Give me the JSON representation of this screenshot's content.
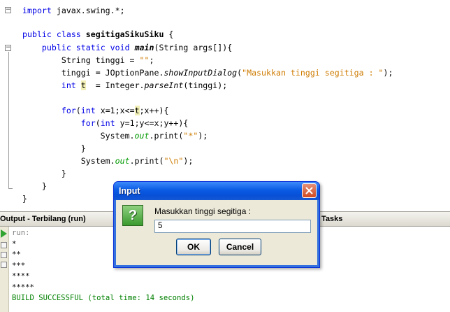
{
  "editor": {
    "lines": [
      {
        "id": "l1",
        "parts": [
          {
            "t": "import",
            "c": "kw"
          },
          {
            "t": " javax.swing.*;",
            "c": ""
          }
        ]
      },
      {
        "id": "l2",
        "parts": []
      },
      {
        "id": "l3",
        "parts": [
          {
            "t": "public",
            "c": "kw"
          },
          {
            "t": " ",
            "c": ""
          },
          {
            "t": "class",
            "c": "kw"
          },
          {
            "t": " ",
            "c": ""
          },
          {
            "t": "segitigaSikuSiku",
            "c": "bold"
          },
          {
            "t": " {",
            "c": ""
          }
        ]
      },
      {
        "id": "l4",
        "parts": [
          {
            "t": "    ",
            "c": ""
          },
          {
            "t": "public",
            "c": "kw"
          },
          {
            "t": " ",
            "c": ""
          },
          {
            "t": "static",
            "c": "kw"
          },
          {
            "t": " ",
            "c": ""
          },
          {
            "t": "void",
            "c": "kw"
          },
          {
            "t": " ",
            "c": ""
          },
          {
            "t": "main",
            "c": "bold it"
          },
          {
            "t": "(String args[]){",
            "c": ""
          }
        ]
      },
      {
        "id": "l5",
        "parts": [
          {
            "t": "        String tinggi = ",
            "c": ""
          },
          {
            "t": "\"\"",
            "c": "str"
          },
          {
            "t": ";",
            "c": ""
          }
        ]
      },
      {
        "id": "l6",
        "parts": [
          {
            "t": "        tinggi = JOptionPane.",
            "c": ""
          },
          {
            "t": "showInputDialog",
            "c": "it"
          },
          {
            "t": "(",
            "c": ""
          },
          {
            "t": "\"Masukkan tinggi segitiga : \"",
            "c": "str"
          },
          {
            "t": ");",
            "c": ""
          }
        ]
      },
      {
        "id": "l7",
        "parts": [
          {
            "t": "        ",
            "c": ""
          },
          {
            "t": "int",
            "c": "kw"
          },
          {
            "t": " ",
            "c": ""
          },
          {
            "t": "t",
            "c": "hl"
          },
          {
            "t": "  = Integer.",
            "c": ""
          },
          {
            "t": "parseInt",
            "c": "it"
          },
          {
            "t": "(tinggi);",
            "c": ""
          }
        ]
      },
      {
        "id": "l8",
        "parts": []
      },
      {
        "id": "l9",
        "parts": [
          {
            "t": "        ",
            "c": ""
          },
          {
            "t": "for",
            "c": "kw"
          },
          {
            "t": "(",
            "c": ""
          },
          {
            "t": "int",
            "c": "kw"
          },
          {
            "t": " x=1;x<=",
            "c": ""
          },
          {
            "t": "t",
            "c": "hl"
          },
          {
            "t": ";x++){",
            "c": ""
          }
        ]
      },
      {
        "id": "l10",
        "parts": [
          {
            "t": "            ",
            "c": ""
          },
          {
            "t": "for",
            "c": "kw"
          },
          {
            "t": "(",
            "c": ""
          },
          {
            "t": "int",
            "c": "kw"
          },
          {
            "t": " y=1;y<=x;y++){",
            "c": ""
          }
        ]
      },
      {
        "id": "l11",
        "parts": [
          {
            "t": "                System.",
            "c": ""
          },
          {
            "t": "out",
            "c": "fld"
          },
          {
            "t": ".print(",
            "c": ""
          },
          {
            "t": "\"*\"",
            "c": "str"
          },
          {
            "t": ");",
            "c": ""
          }
        ]
      },
      {
        "id": "l12",
        "parts": [
          {
            "t": "            }",
            "c": ""
          }
        ]
      },
      {
        "id": "l13",
        "parts": [
          {
            "t": "            System.",
            "c": ""
          },
          {
            "t": "out",
            "c": "fld"
          },
          {
            "t": ".print(",
            "c": ""
          },
          {
            "t": "\"\\n\"",
            "c": "str"
          },
          {
            "t": ");",
            "c": ""
          }
        ]
      },
      {
        "id": "l14",
        "parts": [
          {
            "t": "        }",
            "c": ""
          }
        ]
      },
      {
        "id": "l15",
        "parts": [
          {
            "t": "    }",
            "c": ""
          }
        ]
      },
      {
        "id": "l16",
        "parts": [
          {
            "t": "}",
            "c": ""
          }
        ]
      }
    ]
  },
  "output_panel": {
    "tab_label": "Output - Terbilang (run)",
    "tasks_tab_label": "Tasks",
    "lines": [
      {
        "text": "run:",
        "style": "out-gray"
      },
      {
        "text": "*",
        "style": "out-black"
      },
      {
        "text": "**",
        "style": "out-black"
      },
      {
        "text": "***",
        "style": "out-black"
      },
      {
        "text": "****",
        "style": "out-black"
      },
      {
        "text": "*****",
        "style": "out-black"
      },
      {
        "text": "BUILD SUCCESSFUL (total time: 14 seconds)",
        "style": "out-green"
      }
    ]
  },
  "dialog": {
    "title": "Input",
    "icon": "question-icon",
    "icon_glyph": "?",
    "prompt": "Masukkan tinggi segitiga :",
    "input_value": "5",
    "ok_label": "OK",
    "cancel_label": "Cancel"
  }
}
